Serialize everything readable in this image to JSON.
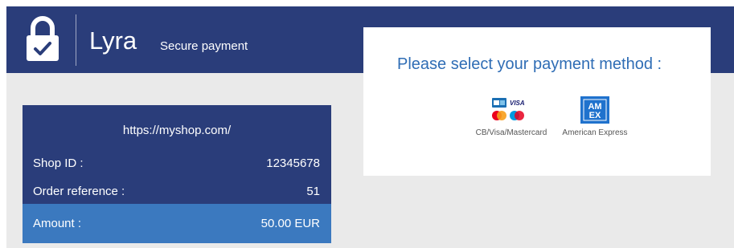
{
  "header": {
    "brand": "Lyra",
    "tagline": "Secure payment"
  },
  "summary": {
    "shop_url": "https://myshop.com/",
    "shop_id_label": "Shop ID :",
    "shop_id_value": "12345678",
    "order_ref_label": "Order reference :",
    "order_ref_value": "51",
    "amount_label": "Amount :",
    "amount_value": "50.00 EUR"
  },
  "payment": {
    "title": "Please select your payment method :",
    "methods": [
      {
        "label": "CB/Visa/Mastercard",
        "icon": "cb-visa-mastercard-icon"
      },
      {
        "label": "American Express",
        "icon": "amex-icon"
      }
    ]
  },
  "colors": {
    "header_bg": "#2a3d7a",
    "amount_bg": "#3b79bf",
    "title_text": "#2f6db5",
    "page_bg": "#eaeaea"
  }
}
